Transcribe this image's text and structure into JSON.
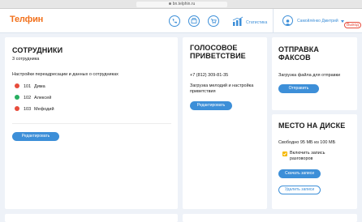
{
  "browser": {
    "url": "bn.telphin.ru"
  },
  "header": {
    "logo": "Телфин",
    "stats_label": "Статистика",
    "user_name": "Самойлёнко Дмитрий",
    "exit_label": "Выход"
  },
  "employees": {
    "title": "СОТРУДНИКИ",
    "count": "3 сотрудника",
    "description": "Настройки переадресации и данных о сотрудниках",
    "list": [
      {
        "number": "101",
        "name": "Дима",
        "color": "#e74c3c"
      },
      {
        "number": "102",
        "name": "Алексей",
        "color": "#27ae60"
      },
      {
        "number": "103",
        "name": "Мефодий",
        "color": "#e74c3c"
      }
    ],
    "edit_label": "Редактировать"
  },
  "greeting": {
    "title_line1": "ГОЛОСОВОЕ",
    "title_line2": "ПРИВЕТСТВИЕ",
    "phone": "+7 (812) 309-81-35",
    "desc_line1": "Загрузка мелодий и настройка",
    "desc_line2": "приветствия",
    "edit_label": "Редактировать"
  },
  "fax": {
    "title_line1": "ОТПРАВКА",
    "title_line2": "ФАКСОВ",
    "desc": "Загрузка файла для отправки",
    "send_label": "Отправить"
  },
  "disk": {
    "title": "МЕСТО НА ДИСКЕ",
    "free": "Свободно 95 МБ из 100 МБ",
    "record_line1": "Включить запись",
    "record_line2": "разговоров",
    "record_enabled": true,
    "download_label": "Скачать записи",
    "delete_label": "Удалить записи"
  },
  "colors": {
    "accent": "#3d8fd8",
    "brand": "#f2711c",
    "background": "#eef2f8"
  }
}
